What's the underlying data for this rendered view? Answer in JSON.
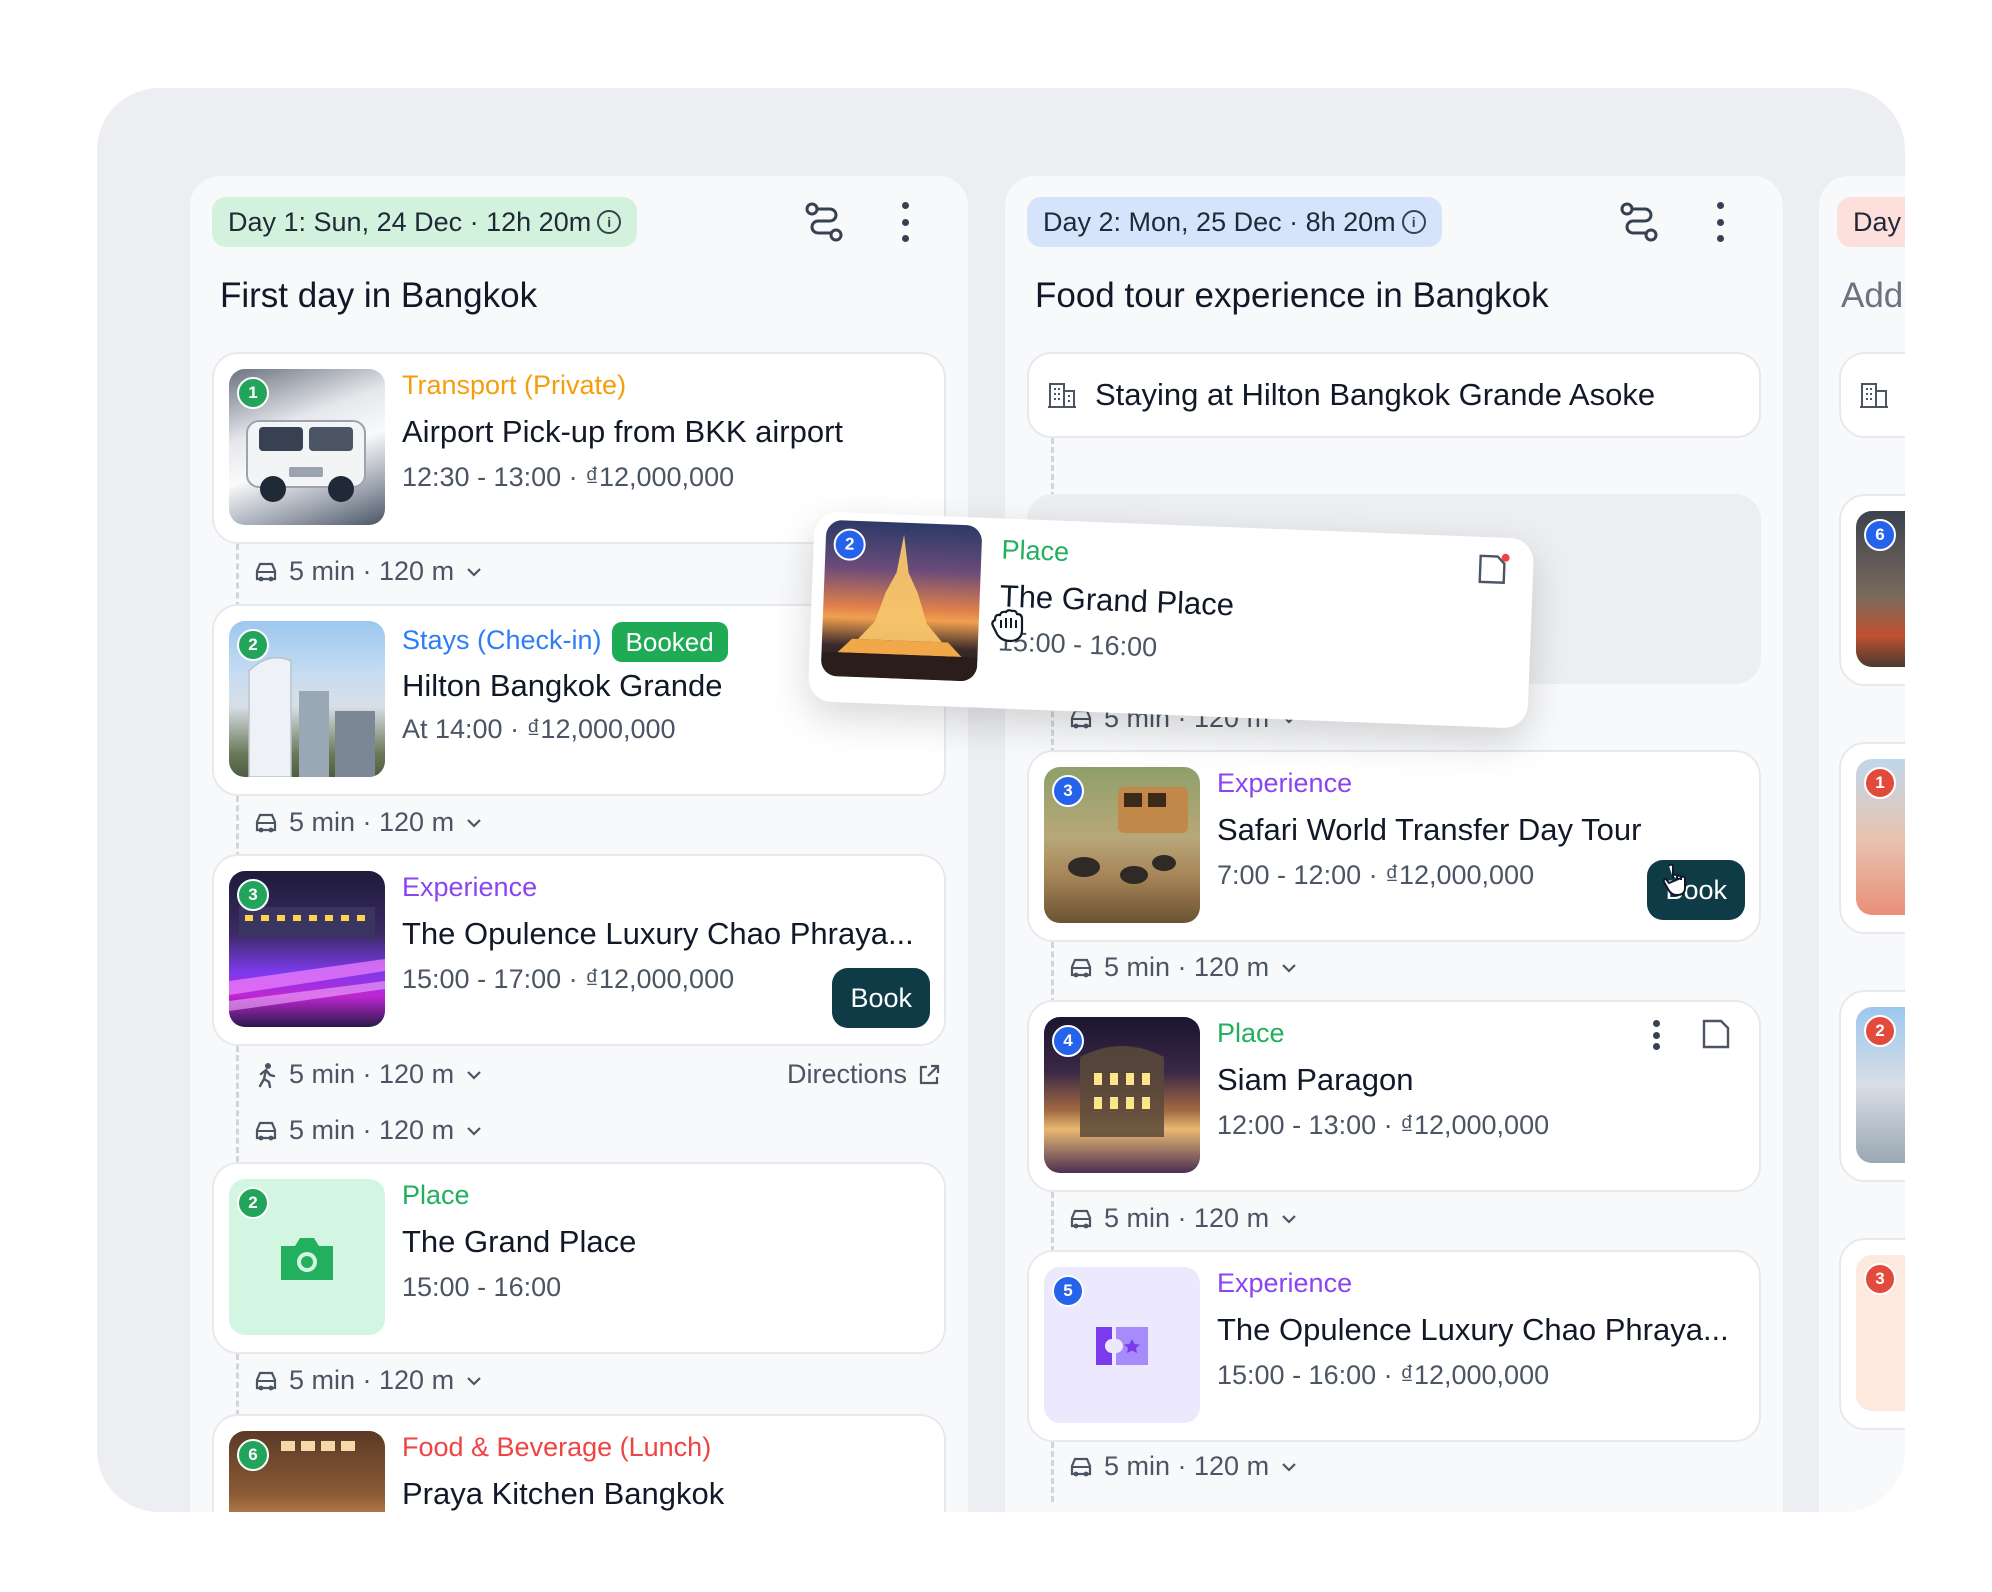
{
  "columns": [
    {
      "badge": "Day 1: Sun, 24 Dec · 12h 20m",
      "badge_color": "#d3f2de",
      "title": "First day in Bangkok",
      "items": [
        {
          "number": "1",
          "category": "Transport (Private)",
          "name": "Airport Pick-up from BKK airport",
          "meta": "12:30 - 13:00 · ₫12,000,000"
        },
        {
          "number": "2",
          "category": "Stays (Check-in)",
          "badge": "Booked",
          "name": "Hilton Bangkok Grande",
          "meta": "At 14:00 · ₫12,000,000"
        },
        {
          "number": "3",
          "category": "Experience",
          "name": "The Opulence Luxury Chao Phraya...",
          "meta": "15:00 - 17:00 · ₫12,000,000",
          "button": "Book"
        },
        {
          "number": "2",
          "category": "Place",
          "name": "The Grand Place",
          "meta": "15:00 - 16:00"
        },
        {
          "number": "6",
          "category": "Food & Beverage (Lunch)",
          "name": "Praya Kitchen Bangkok"
        }
      ],
      "travel": [
        "5 min · 120 m",
        "5 min · 120 m",
        "5 min · 120 m",
        "5 min · 120 m",
        "5 min · 120 m"
      ],
      "directions": "Directions"
    },
    {
      "badge": "Day 2: Mon, 25 Dec · 8h 20m",
      "badge_color": "#d6e4fb",
      "title": "Food tour experience in Bangkok",
      "stay": "Staying at Hilton Bangkok Grande Asoke",
      "items": [
        {
          "number": "3",
          "category": "Experience",
          "name": "Safari World Transfer Day Tour",
          "meta": "7:00 - 12:00 · ₫12,000,000",
          "button": "Book"
        },
        {
          "number": "4",
          "category": "Place",
          "name": "Siam Paragon",
          "meta": "12:00 - 13:00 · ₫12,000,000"
        },
        {
          "number": "5",
          "category": "Experience",
          "name": "The Opulence Luxury Chao Phraya...",
          "meta": "15:00 - 16:00 · ₫12,000,000"
        }
      ],
      "travel": [
        "5 min · 120 m",
        "5 min · 120 m",
        "5 min · 120 m",
        "5 min · 120 m"
      ]
    },
    {
      "badge": "Day",
      "badge_color": "#fde0dc",
      "title": "Add",
      "numbers": [
        "6",
        "1",
        "2",
        "3"
      ]
    }
  ],
  "dragging": {
    "number": "2",
    "category": "Place",
    "name": "The Grand Place",
    "meta": "15:00 - 16:00"
  },
  "colors": {
    "accent_dark": "#0f3b47",
    "place_green": "#22b05f",
    "experience_purple": "#8b45f0",
    "transport_orange": "#f59e0b",
    "stays_blue": "#2f7df6",
    "food_red": "#ef4444"
  }
}
